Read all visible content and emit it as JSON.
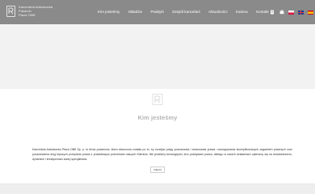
{
  "header": {
    "logo": {
      "icon": "monogram-icon",
      "line1": "Kancelaria Adwokacka",
      "line2": "Piasecki",
      "line3": "Płaza Oltiff"
    },
    "nav": [
      {
        "label": "Kim jesteśmy"
      },
      {
        "label": "Składzie"
      },
      {
        "label": "Praktyki"
      },
      {
        "label": "Zespół kancelarii"
      },
      {
        "label": "Aktualności"
      },
      {
        "label": "Kariera"
      },
      {
        "label": "Kontakt"
      }
    ],
    "tools": {
      "icons": [
        "building-icon",
        "briefcase-icon"
      ],
      "languages": [
        "pl",
        "en",
        "es"
      ]
    },
    "colors": {
      "bar": "#8a8a8a",
      "text": "#ffffff"
    }
  },
  "about": {
    "icon": "monogram-icon",
    "title": "Kim jesteśmy",
    "paragraph": "Kancelaria Adwokacka Płaza Oltiff Sp. p. to firma prawnicza, która stworzona została po to, by rozwijać pasję poznawania i stosowania prawa, rozwiązywania skomplikowanych zagadnień prawnych oraz poszukiwania drog lepszych przepisów prawa z prawidłowym potrzebami naszych Klientów. Nie jesteśmy bezwzględni, lecz praktykami prawa, dlatego w swoich działaniach opieramy się na doświadczeniu, dynamice i kreatywności kadry specjalistów.",
    "more_label": "więcej",
    "title_color": "#b3b3b3"
  }
}
